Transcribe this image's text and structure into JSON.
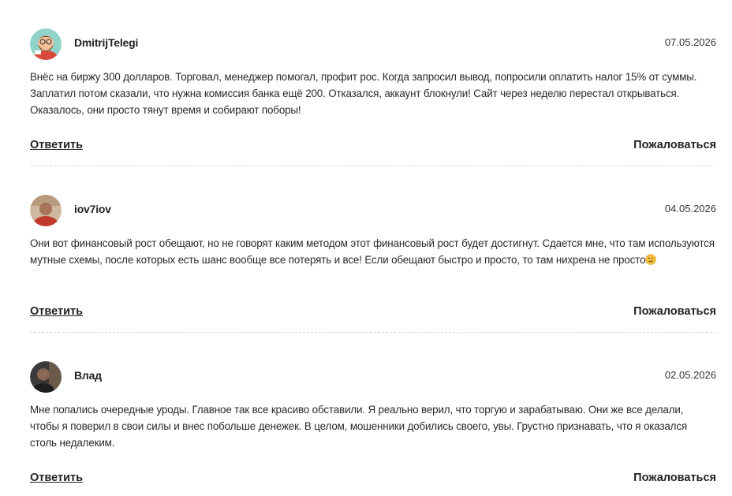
{
  "comments": [
    {
      "author": "DmitrijTelegi",
      "date": "07.05.2026",
      "text": "Внёс на биржу 300 долларов. Торговал, менеджер помогал, профит рос. Когда запросил вывод, попросили оплатить налог 15% от суммы. Заплатил потом сказали, что нужна комиссия банка ещё 200. Отказался, аккаунт блокнули! Сайт через неделю перестал открываться. Оказалось, они просто тянут время и собирают поборы!",
      "reply_label": "Ответить",
      "report_label": "Пожаловаться",
      "avatar_icon": "bearded-man-cartoon-avatar"
    },
    {
      "author": "iov7iov",
      "date": "04.05.2026",
      "text": "Они вот финансовый рост обещают, но не говорят каким методом этот финансовый рост будет достигнут. Сдается мне, что там используются мутные схемы, после которых есть шанс вообще все потерять и все! Если обещают быстро и просто, то там нихрена не просто",
      "emoji_icon": "sad-face-emoji-icon",
      "reply_label": "Ответить",
      "report_label": "Пожаловаться",
      "avatar_icon": "man-in-red-shirt-photo-avatar"
    },
    {
      "author": "Влад",
      "date": "02.05.2026",
      "text": "Мне попались очередные уроды. Главное так все красиво обставили. Я реально верил, что торгую и зарабатываю. Они же все делали, чтобы я поверил в свои силы и внес побольше денежек. В целом, мошенники добились своего, увы. Грустно признавать, что я оказался столь недалеким.",
      "reply_label": "Ответить",
      "report_label": "Пожаловаться",
      "avatar_icon": "dark-photo-avatar"
    }
  ]
}
